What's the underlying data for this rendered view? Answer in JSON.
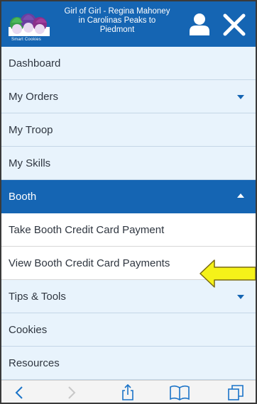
{
  "header": {
    "logo_text": "Smart Cookies",
    "title": "Girl of Girl - Regina Mahoney in Carolinas Peaks to Piedmont",
    "user_icon": "user-icon",
    "close_icon": "close-icon"
  },
  "menu": [
    {
      "label": "Dashboard",
      "caret": null
    },
    {
      "label": "My Orders",
      "caret": "chevron-down-icon"
    },
    {
      "label": "My Troop",
      "caret": null
    },
    {
      "label": "My Skills",
      "caret": null
    },
    {
      "label": "Booth",
      "caret": "chevron-up-icon",
      "expanded": true
    },
    {
      "label": "Take Booth Credit Card Payment",
      "caret": null,
      "submenu": true
    },
    {
      "label": "View Booth Credit Card Payments",
      "caret": null,
      "submenu": true
    },
    {
      "label": "Tips & Tools",
      "caret": "chevron-down-icon"
    },
    {
      "label": "Cookies",
      "caret": null
    },
    {
      "label": "Resources",
      "caret": null
    }
  ],
  "annotation": {
    "icon": "arrow-left-icon",
    "color": "#f5f219"
  },
  "colors": {
    "brand": "#1565b3",
    "menu_bg": "#e8f3fc"
  },
  "browser_toolbar": [
    "back-icon",
    "forward-icon",
    "share-icon",
    "bookmarks-icon",
    "tabs-icon"
  ]
}
